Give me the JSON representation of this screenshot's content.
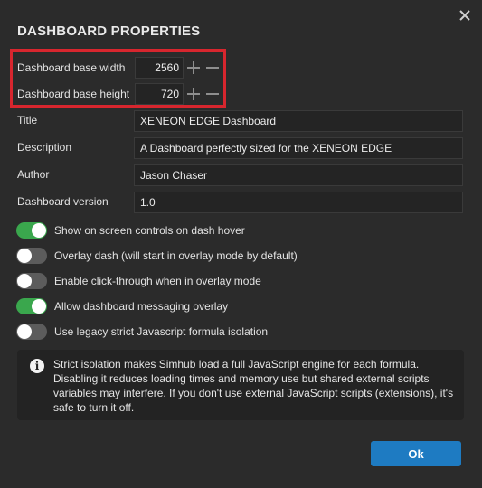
{
  "dialog": {
    "title": "DASHBOARD PROPERTIES",
    "close_icon": "close-icon",
    "ok_label": "Ok"
  },
  "size": {
    "width_label": "Dashboard base width",
    "width_value": "2560",
    "height_label": "Dashboard base height",
    "height_value": "720"
  },
  "fields": {
    "title_label": "Title",
    "title_value": "XENEON EDGE Dashboard",
    "description_label": "Description",
    "description_value": "A Dashboard perfectly sized for the XENEON EDGE",
    "author_label": "Author",
    "author_value": "Jason Chaser",
    "version_label": "Dashboard version",
    "version_value": "1.0"
  },
  "toggles": [
    {
      "label": "Show on screen controls on dash hover",
      "on": true
    },
    {
      "label": "Overlay dash (will start in overlay mode by default)",
      "on": false
    },
    {
      "label": "Enable click-through when in overlay mode",
      "on": false
    },
    {
      "label": "Allow dashboard messaging overlay",
      "on": true
    },
    {
      "label": "Use legacy strict Javascript formula isolation",
      "on": false
    }
  ],
  "info": {
    "icon": "info-icon",
    "line1": "Strict isolation makes Simhub load a full JavaScript engine for each formula.",
    "line2": "Disabling it reduces loading times and memory use but shared external scripts",
    "line3": "variables may interfere. If you don't use external JavaScript scripts (extensions), it's",
    "line4": "safe to turn it off."
  },
  "colors": {
    "highlight": "#d7262e",
    "toggle_on": "#3aa74d",
    "toggle_off": "#5c5c5c",
    "ok_button": "#1e7bc2"
  }
}
